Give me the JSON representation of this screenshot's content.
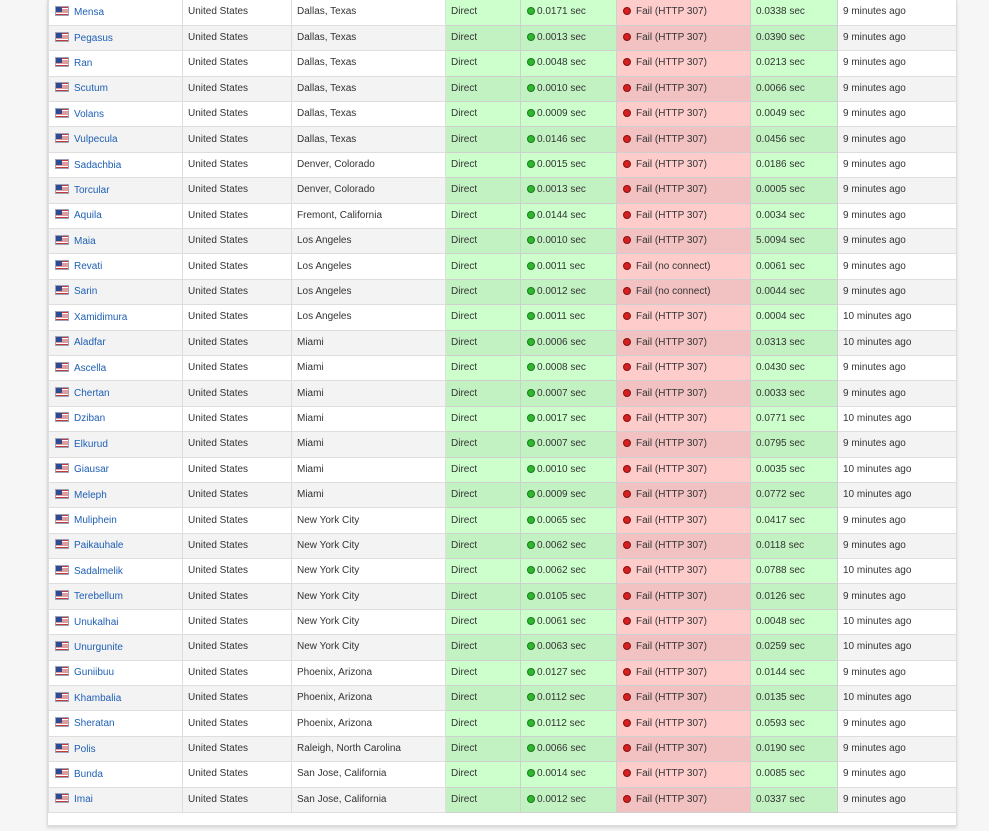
{
  "colors": {
    "link": "#1e5fb5",
    "ok_cell": "#ccffcc",
    "fail_cell": "#ffcccc",
    "ok_dot": "#2eb82e",
    "fail_dot": "#d42020"
  },
  "icons": {
    "flag": "us-flag-icon",
    "ok": "green-status-dot-icon",
    "fail": "red-status-dot-icon"
  },
  "rows": [
    {
      "name": "Mensa",
      "country": "United States",
      "city": "Dallas, Texas",
      "type": "Direct",
      "ping": "0.0171 sec",
      "https": "Fail (HTTP 307)",
      "dns": "0.0338 sec",
      "checked": "9 minutes ago"
    },
    {
      "name": "Pegasus",
      "country": "United States",
      "city": "Dallas, Texas",
      "type": "Direct",
      "ping": "0.0013 sec",
      "https": "Fail (HTTP 307)",
      "dns": "0.0390 sec",
      "checked": "9 minutes ago"
    },
    {
      "name": "Ran",
      "country": "United States",
      "city": "Dallas, Texas",
      "type": "Direct",
      "ping": "0.0048 sec",
      "https": "Fail (HTTP 307)",
      "dns": "0.0213 sec",
      "checked": "9 minutes ago"
    },
    {
      "name": "Scutum",
      "country": "United States",
      "city": "Dallas, Texas",
      "type": "Direct",
      "ping": "0.0010 sec",
      "https": "Fail (HTTP 307)",
      "dns": "0.0066 sec",
      "checked": "9 minutes ago"
    },
    {
      "name": "Volans",
      "country": "United States",
      "city": "Dallas, Texas",
      "type": "Direct",
      "ping": "0.0009 sec",
      "https": "Fail (HTTP 307)",
      "dns": "0.0049 sec",
      "checked": "9 minutes ago"
    },
    {
      "name": "Vulpecula",
      "country": "United States",
      "city": "Dallas, Texas",
      "type": "Direct",
      "ping": "0.0146 sec",
      "https": "Fail (HTTP 307)",
      "dns": "0.0456 sec",
      "checked": "9 minutes ago"
    },
    {
      "name": "Sadachbia",
      "country": "United States",
      "city": "Denver, Colorado",
      "type": "Direct",
      "ping": "0.0015 sec",
      "https": "Fail (HTTP 307)",
      "dns": "0.0186 sec",
      "checked": "9 minutes ago"
    },
    {
      "name": "Torcular",
      "country": "United States",
      "city": "Denver, Colorado",
      "type": "Direct",
      "ping": "0.0013 sec",
      "https": "Fail (HTTP 307)",
      "dns": "0.0005 sec",
      "checked": "9 minutes ago"
    },
    {
      "name": "Aquila",
      "country": "United States",
      "city": "Fremont, California",
      "type": "Direct",
      "ping": "0.0144 sec",
      "https": "Fail (HTTP 307)",
      "dns": "0.0034 sec",
      "checked": "9 minutes ago"
    },
    {
      "name": "Maia",
      "country": "United States",
      "city": "Los Angeles",
      "type": "Direct",
      "ping": "0.0010 sec",
      "https": "Fail (HTTP 307)",
      "dns": "5.0094 sec",
      "checked": "9 minutes ago"
    },
    {
      "name": "Revati",
      "country": "United States",
      "city": "Los Angeles",
      "type": "Direct",
      "ping": "0.0011 sec",
      "https": "Fail (no connect)",
      "dns": "0.0061 sec",
      "checked": "9 minutes ago"
    },
    {
      "name": "Sarin",
      "country": "United States",
      "city": "Los Angeles",
      "type": "Direct",
      "ping": "0.0012 sec",
      "https": "Fail (no connect)",
      "dns": "0.0044 sec",
      "checked": "9 minutes ago"
    },
    {
      "name": "Xamidimura",
      "country": "United States",
      "city": "Los Angeles",
      "type": "Direct",
      "ping": "0.0011 sec",
      "https": "Fail (HTTP 307)",
      "dns": "0.0004 sec",
      "checked": "10 minutes ago"
    },
    {
      "name": "Aladfar",
      "country": "United States",
      "city": "Miami",
      "type": "Direct",
      "ping": "0.0006 sec",
      "https": "Fail (HTTP 307)",
      "dns": "0.0313 sec",
      "checked": "10 minutes ago"
    },
    {
      "name": "Ascella",
      "country": "United States",
      "city": "Miami",
      "type": "Direct",
      "ping": "0.0008 sec",
      "https": "Fail (HTTP 307)",
      "dns": "0.0430 sec",
      "checked": "9 minutes ago"
    },
    {
      "name": "Chertan",
      "country": "United States",
      "city": "Miami",
      "type": "Direct",
      "ping": "0.0007 sec",
      "https": "Fail (HTTP 307)",
      "dns": "0.0033 sec",
      "checked": "9 minutes ago"
    },
    {
      "name": "Dziban",
      "country": "United States",
      "city": "Miami",
      "type": "Direct",
      "ping": "0.0017 sec",
      "https": "Fail (HTTP 307)",
      "dns": "0.0771 sec",
      "checked": "10 minutes ago"
    },
    {
      "name": "Elkurud",
      "country": "United States",
      "city": "Miami",
      "type": "Direct",
      "ping": "0.0007 sec",
      "https": "Fail (HTTP 307)",
      "dns": "0.0795 sec",
      "checked": "9 minutes ago"
    },
    {
      "name": "Giausar",
      "country": "United States",
      "city": "Miami",
      "type": "Direct",
      "ping": "0.0010 sec",
      "https": "Fail (HTTP 307)",
      "dns": "0.0035 sec",
      "checked": "10 minutes ago"
    },
    {
      "name": "Meleph",
      "country": "United States",
      "city": "Miami",
      "type": "Direct",
      "ping": "0.0009 sec",
      "https": "Fail (HTTP 307)",
      "dns": "0.0772 sec",
      "checked": "10 minutes ago"
    },
    {
      "name": "Muliphein",
      "country": "United States",
      "city": "New York City",
      "type": "Direct",
      "ping": "0.0065 sec",
      "https": "Fail (HTTP 307)",
      "dns": "0.0417 sec",
      "checked": "9 minutes ago"
    },
    {
      "name": "Paikauhale",
      "country": "United States",
      "city": "New York City",
      "type": "Direct",
      "ping": "0.0062 sec",
      "https": "Fail (HTTP 307)",
      "dns": "0.0118 sec",
      "checked": "9 minutes ago"
    },
    {
      "name": "Sadalmelik",
      "country": "United States",
      "city": "New York City",
      "type": "Direct",
      "ping": "0.0062 sec",
      "https": "Fail (HTTP 307)",
      "dns": "0.0788 sec",
      "checked": "10 minutes ago"
    },
    {
      "name": "Terebellum",
      "country": "United States",
      "city": "New York City",
      "type": "Direct",
      "ping": "0.0105 sec",
      "https": "Fail (HTTP 307)",
      "dns": "0.0126 sec",
      "checked": "9 minutes ago"
    },
    {
      "name": "Unukalhai",
      "country": "United States",
      "city": "New York City",
      "type": "Direct",
      "ping": "0.0061 sec",
      "https": "Fail (HTTP 307)",
      "dns": "0.0048 sec",
      "checked": "10 minutes ago"
    },
    {
      "name": "Unurgunite",
      "country": "United States",
      "city": "New York City",
      "type": "Direct",
      "ping": "0.0063 sec",
      "https": "Fail (HTTP 307)",
      "dns": "0.0259 sec",
      "checked": "10 minutes ago"
    },
    {
      "name": "Guniibuu",
      "country": "United States",
      "city": "Phoenix, Arizona",
      "type": "Direct",
      "ping": "0.0127 sec",
      "https": "Fail (HTTP 307)",
      "dns": "0.0144 sec",
      "checked": "9 minutes ago"
    },
    {
      "name": "Khambalia",
      "country": "United States",
      "city": "Phoenix, Arizona",
      "type": "Direct",
      "ping": "0.0112 sec",
      "https": "Fail (HTTP 307)",
      "dns": "0.0135 sec",
      "checked": "10 minutes ago"
    },
    {
      "name": "Sheratan",
      "country": "United States",
      "city": "Phoenix, Arizona",
      "type": "Direct",
      "ping": "0.0112 sec",
      "https": "Fail (HTTP 307)",
      "dns": "0.0593 sec",
      "checked": "9 minutes ago"
    },
    {
      "name": "Polis",
      "country": "United States",
      "city": "Raleigh, North Carolina",
      "type": "Direct",
      "ping": "0.0066 sec",
      "https": "Fail (HTTP 307)",
      "dns": "0.0190 sec",
      "checked": "9 minutes ago"
    },
    {
      "name": "Bunda",
      "country": "United States",
      "city": "San Jose, California",
      "type": "Direct",
      "ping": "0.0014 sec",
      "https": "Fail (HTTP 307)",
      "dns": "0.0085 sec",
      "checked": "9 minutes ago"
    },
    {
      "name": "Imai",
      "country": "United States",
      "city": "San Jose, California",
      "type": "Direct",
      "ping": "0.0012 sec",
      "https": "Fail (HTTP 307)",
      "dns": "0.0337 sec",
      "checked": "9 minutes ago"
    }
  ]
}
